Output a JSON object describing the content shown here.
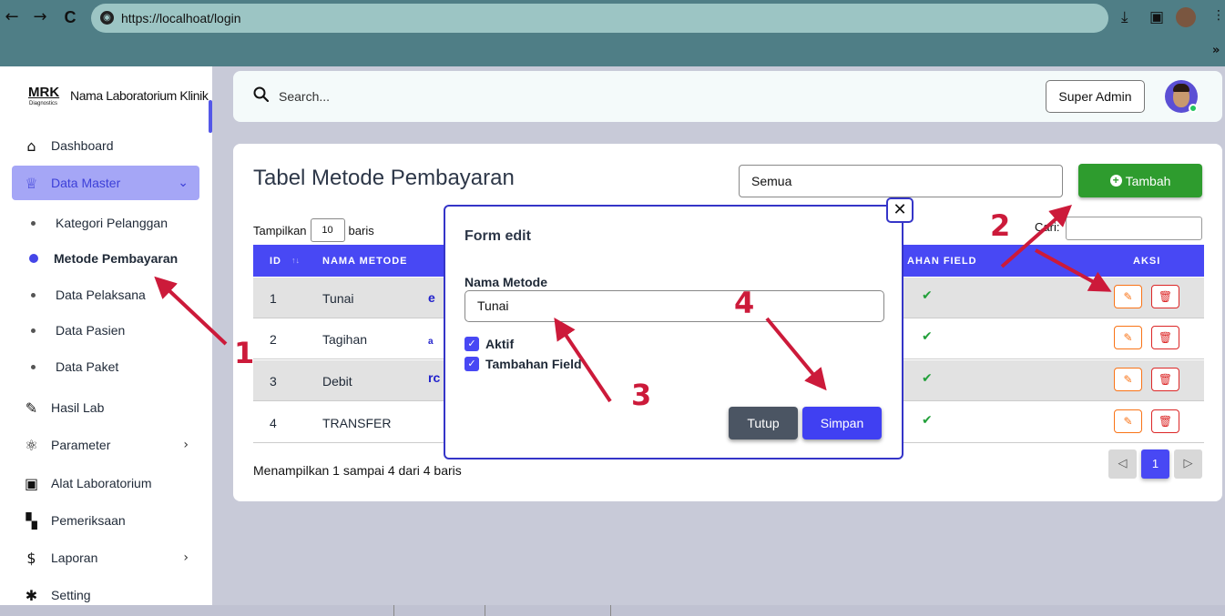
{
  "browser": {
    "url": "https://localhoat/login",
    "back_icon": "←",
    "forward_icon": "→",
    "reload_icon": "C",
    "overflow_icon": "»"
  },
  "brand": {
    "logo": "MRK",
    "logo_sub": "Diagnostics",
    "name": "Nama Laboratorium Klinik"
  },
  "sidebar": {
    "items": [
      {
        "label": "Dashboard",
        "icon": "⌂"
      },
      {
        "label": "Data Master",
        "icon": "♕"
      },
      {
        "label": "Hasil Lab",
        "icon": "✎"
      },
      {
        "label": "Parameter",
        "icon": "⚛"
      },
      {
        "label": "Alat Laboratorium",
        "icon": "▣"
      },
      {
        "label": "Pemeriksaan",
        "icon": "▚"
      },
      {
        "label": "Laporan",
        "icon": "$"
      },
      {
        "label": "Setting",
        "icon": "✱"
      }
    ],
    "sub_items": [
      "Kategori Pelanggan",
      "Metode Pembayaran",
      "Data Pelaksana",
      "Data Pasien",
      "Data Paket"
    ]
  },
  "topbar": {
    "search_placeholder": "Search...",
    "role": "Super Admin"
  },
  "card": {
    "title": "Tabel Metode Pembayaran",
    "filter_value": "Semua",
    "add_label": "Tambah",
    "show_prefix": "Tampilkan",
    "show_count": "10",
    "show_suffix": "baris",
    "search_label": "Cari:",
    "columns": {
      "id": "ID",
      "sort": "↑↓",
      "name": "NAMA METODE",
      "field": "AHAN FIELD",
      "actions": "AKSI"
    },
    "rows": [
      {
        "id": "1",
        "name": "Tunai",
        "frag": "e"
      },
      {
        "id": "2",
        "name": "Tagihan",
        "frag": "a"
      },
      {
        "id": "3",
        "name": "Debit",
        "frag": "rc"
      },
      {
        "id": "4",
        "name": "TRANSFER",
        "frag": ""
      }
    ],
    "info": "Menampilkan 1 sampai 4 dari 4 baris",
    "page_prev": "◁",
    "page_current": "1",
    "page_next": "▷"
  },
  "modal": {
    "title": "Form edit",
    "close": "✕",
    "field_label": "Nama Metode",
    "field_value": "Tunai",
    "checkbox_aktif": "Aktif",
    "checkbox_tambahan": "Tambahan Field",
    "cancel": "Tutup",
    "save": "Simpan"
  },
  "annotations": [
    "1",
    "2",
    "3",
    "4"
  ],
  "colors": {
    "primary": "#4848f4",
    "success": "#2e9c2e",
    "annotation": "#cc1a3a"
  }
}
